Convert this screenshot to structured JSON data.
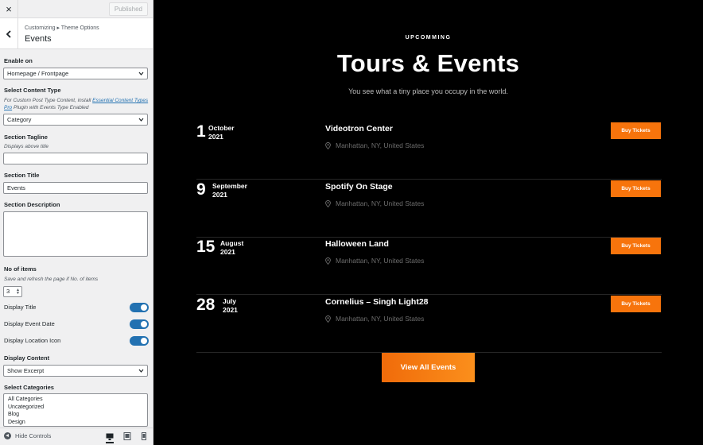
{
  "sidebar": {
    "close_icon": "×",
    "published_label": "Published",
    "breadcrumb": "Customizing ▸ Theme Options",
    "section_title": "Events",
    "enable_on": {
      "label": "Enable on",
      "value": "Homepage / Frontpage"
    },
    "content_type": {
      "label": "Select Content Type",
      "desc_prefix": "For Custom Post Type Content, install",
      "desc_link": "Essential Content Types Pro",
      "desc_suffix": "Plugin with Events Type Enabled",
      "value": "Category"
    },
    "section_tagline": {
      "label": "Section Tagline",
      "desc": "Displays above title",
      "value": ""
    },
    "section_title_field": {
      "label": "Section Title",
      "value": "Events"
    },
    "section_description": {
      "label": "Section Description",
      "value": ""
    },
    "no_of_items": {
      "label": "No of items",
      "desc": "Save and refresh the page if No. of items",
      "value": "3"
    },
    "toggles": [
      {
        "label": "Display Title",
        "on": true
      },
      {
        "label": "Display Event Date",
        "on": true
      },
      {
        "label": "Display Location Icon",
        "on": true
      }
    ],
    "display_content": {
      "label": "Display Content",
      "value": "Show Excerpt"
    },
    "select_categories": {
      "label": "Select Categories",
      "options": [
        "All Categories",
        "Uncategorized",
        "Blog",
        "Design"
      ]
    },
    "footer": {
      "hide_controls": "Hide Controls"
    }
  },
  "preview": {
    "eyebrow": "UPCOMMING",
    "title": "Tours & Events",
    "tagline": "You see what a tiny place you occupy in the world.",
    "events": [
      {
        "day": "1",
        "month": "October",
        "year": "2021",
        "name": "Videotron Center",
        "location": "Manhattan, NY, United States",
        "button": "Buy Tickets"
      },
      {
        "day": "9",
        "month": "September",
        "year": "2021",
        "name": "Spotify On Stage",
        "location": "Manhattan, NY, United States",
        "button": "Buy Tickets"
      },
      {
        "day": "15",
        "month": "August",
        "year": "2021",
        "name": "Halloween Land",
        "location": "Manhattan, NY, United States",
        "button": "Buy Tickets"
      },
      {
        "day": "28",
        "month": "July",
        "year": "2021",
        "name": "Cornelius – Singh Light28",
        "location": "Manhattan, NY, United States",
        "button": "Buy Tickets"
      }
    ],
    "view_all": "View All Events"
  },
  "colors": {
    "accent": "#f7740c",
    "toggle": "#2271b1",
    "background": "#000000"
  }
}
